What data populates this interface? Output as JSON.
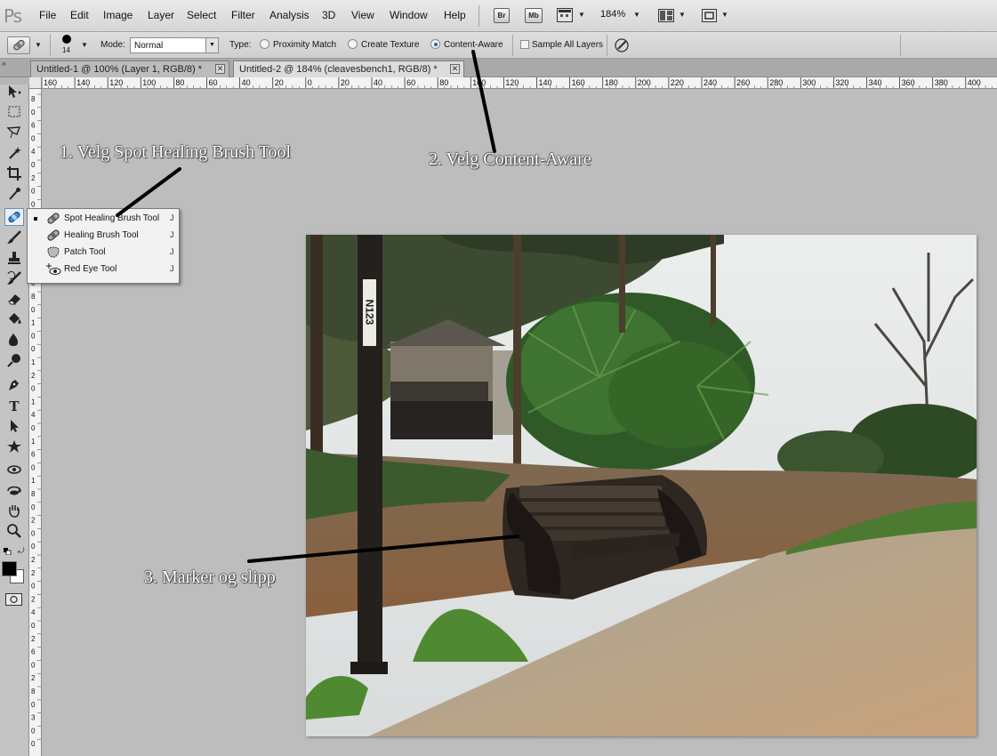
{
  "app": {
    "logo": "Ps"
  },
  "menubar": {
    "items": [
      "File",
      "Edit",
      "Image",
      "Layer",
      "Select",
      "Filter",
      "Analysis",
      "3D",
      "View",
      "Window",
      "Help"
    ],
    "bridge_label": "Br",
    "minibridge_label": "Mb",
    "zoom_level": "184%"
  },
  "options": {
    "brush_size": "14",
    "mode_label": "Mode:",
    "mode_value": "Normal",
    "type_label": "Type:",
    "type_options": [
      "Proximity Match",
      "Create Texture",
      "Content-Aware"
    ],
    "selected_type": "Content-Aware",
    "sample_all_layers": "Sample All Layers"
  },
  "tabs": [
    {
      "label": "Untitled-1 @ 100% (Layer 1, RGB/8) *",
      "active": false
    },
    {
      "label": "Untitled-2 @ 184% (cleavesbench1, RGB/8) *",
      "active": true
    }
  ],
  "ruler_top_labels": [
    "160",
    "140",
    "120",
    "100",
    "80",
    "60",
    "40",
    "20",
    "0",
    "20",
    "40",
    "60",
    "80",
    "100",
    "120",
    "140",
    "160",
    "180",
    "200",
    "220",
    "240",
    "260",
    "280",
    "300",
    "320",
    "340",
    "360",
    "380",
    "400"
  ],
  "ruler_left_labels": [
    "8",
    "0",
    "6",
    "0",
    "4",
    "0",
    "2",
    "0",
    "0",
    "2",
    "0",
    "4",
    "0",
    "6",
    "0",
    "8",
    "0",
    "1",
    "0",
    "0",
    "1",
    "2",
    "0",
    "1",
    "4",
    "0",
    "1",
    "6",
    "0",
    "1",
    "8",
    "0",
    "2",
    "0",
    "0",
    "2",
    "2",
    "0",
    "2",
    "4",
    "0",
    "2",
    "6",
    "0",
    "2",
    "8",
    "0",
    "3",
    "0",
    "0"
  ],
  "tool_flyout": {
    "items": [
      {
        "label": "Spot Healing Brush Tool",
        "key": "J",
        "selected": true
      },
      {
        "label": "Healing Brush Tool",
        "key": "J",
        "selected": false
      },
      {
        "label": "Patch Tool",
        "key": "J",
        "selected": false
      },
      {
        "label": "Red Eye Tool",
        "key": "J",
        "selected": false
      }
    ]
  },
  "annotations": {
    "step1": "1. Velg Spot Healing Brush Tool",
    "step2": "2. Velg Content-Aware",
    "step3": "3. Marker og slipp"
  },
  "photo": {
    "post_sign": "N123"
  },
  "colors": {
    "accent_selection": "#2a5ea8",
    "annotation_text": "#ffffff",
    "annotation_line": "#000000"
  }
}
